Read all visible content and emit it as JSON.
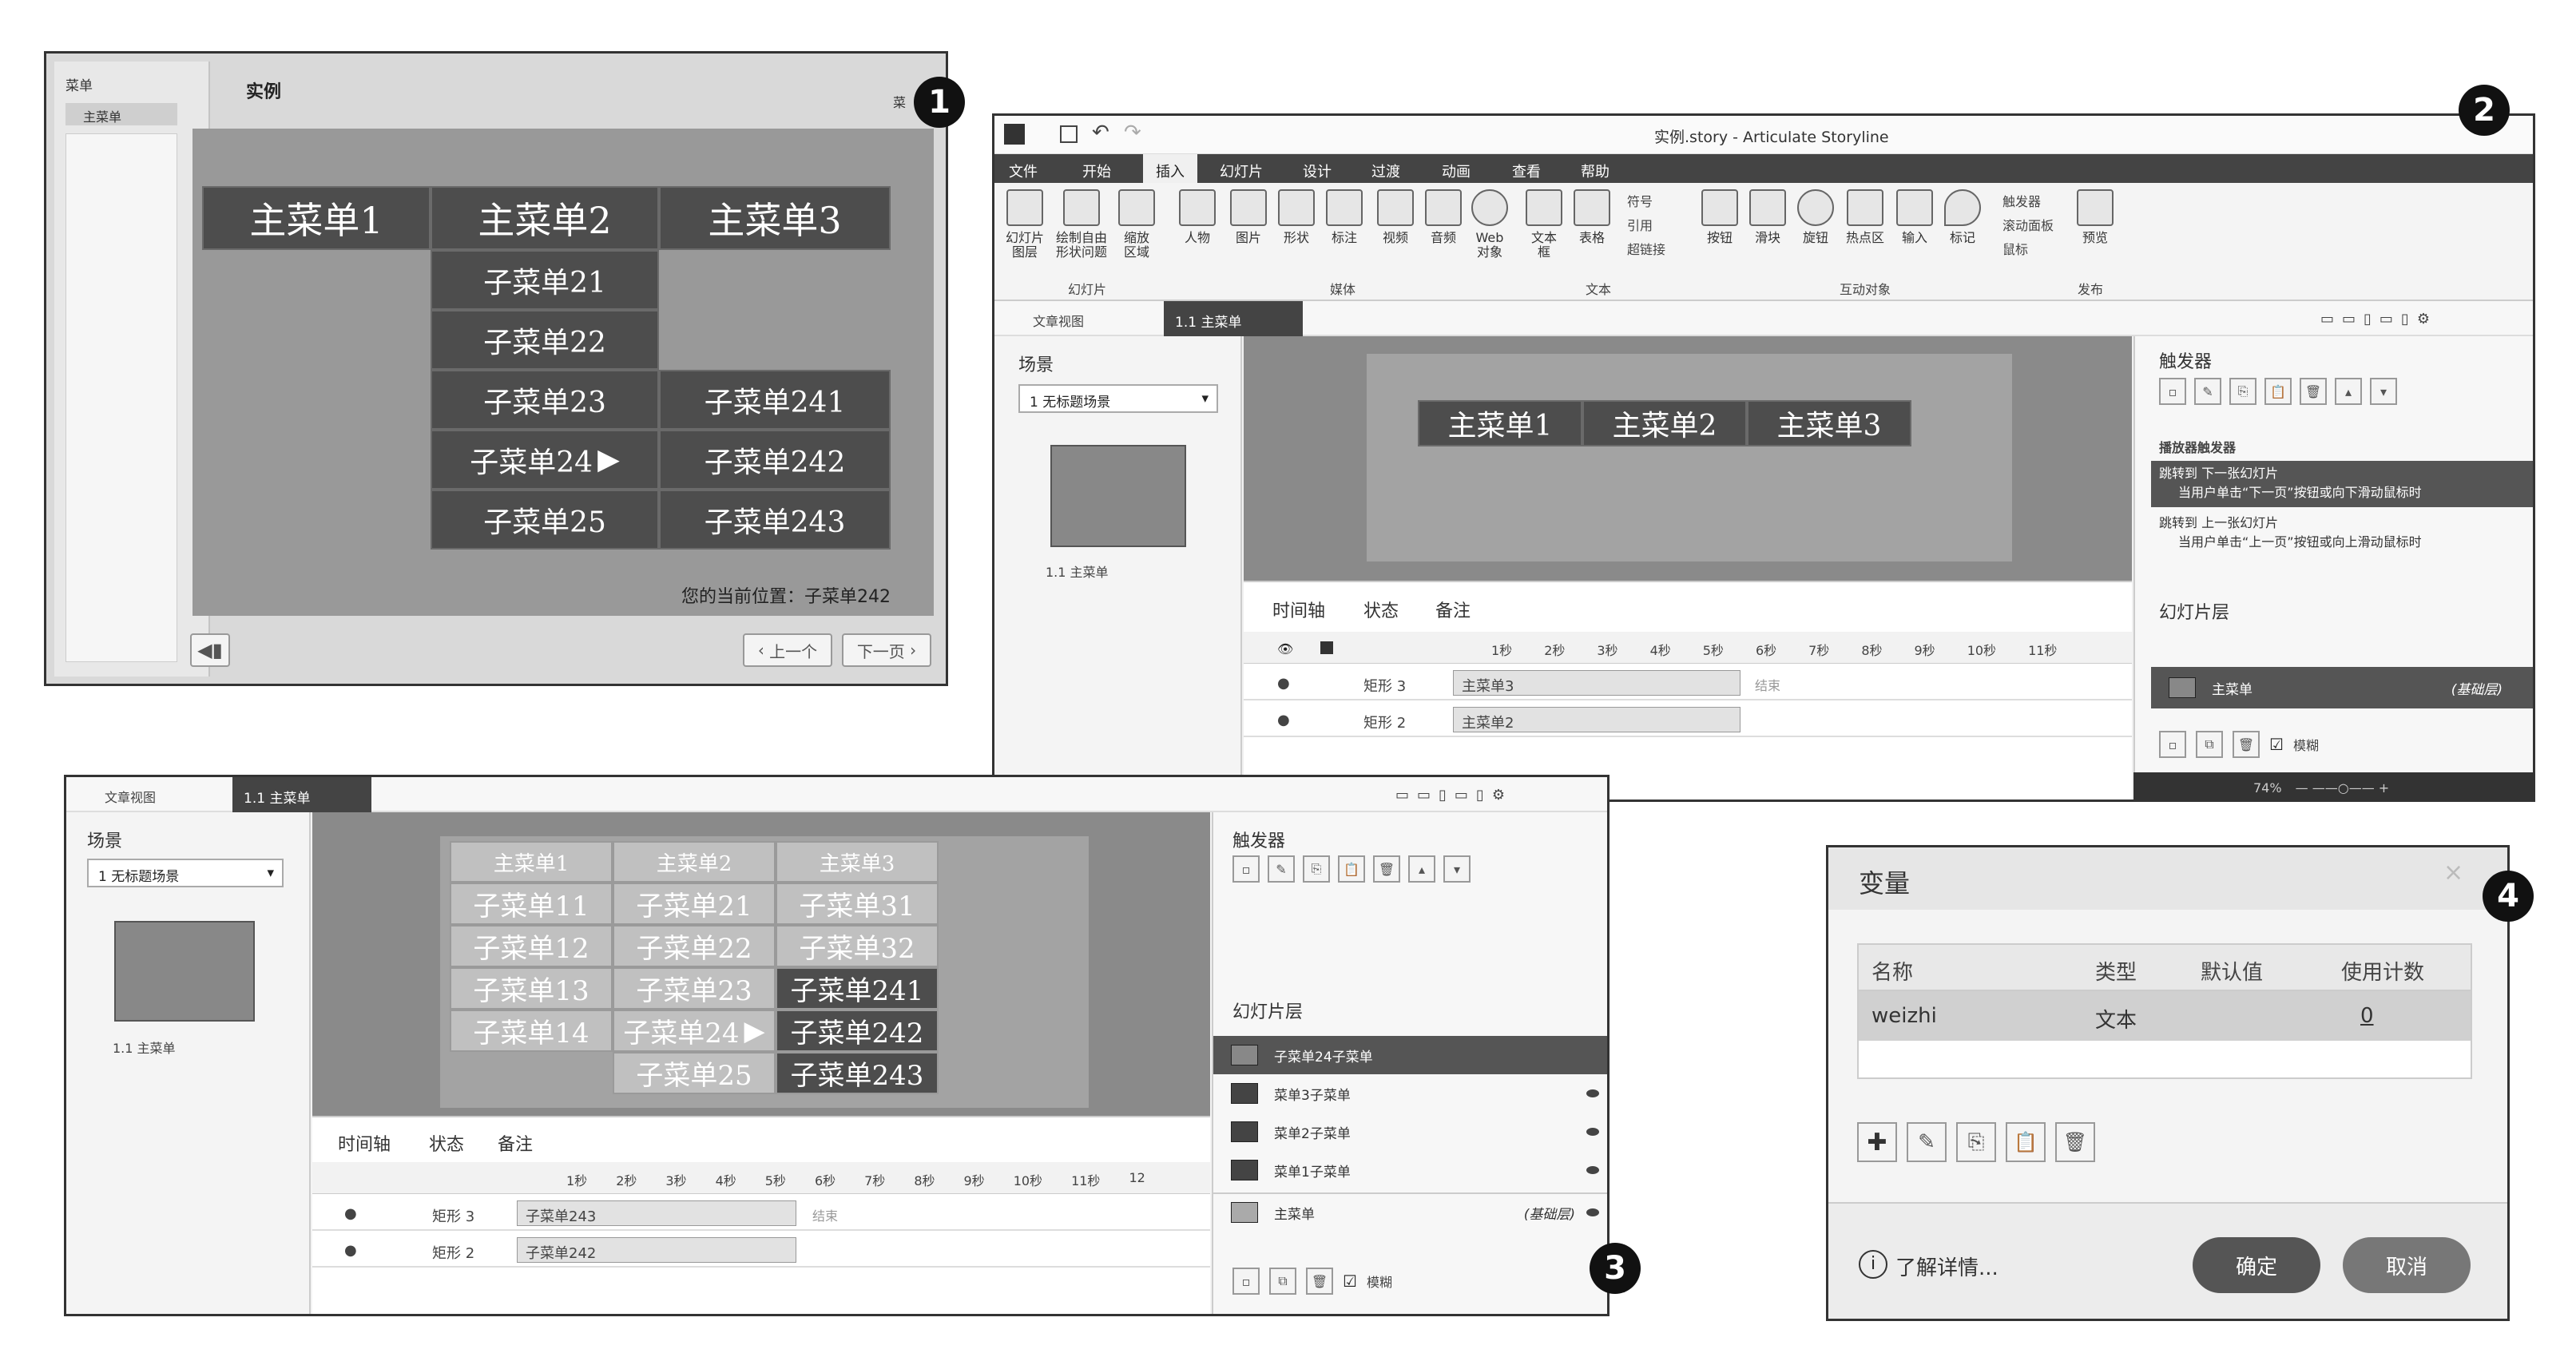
{
  "badges": [
    "1",
    "2",
    "3",
    "4"
  ],
  "panel1": {
    "sidebar_tab": "菜单",
    "sidebar_item": "主菜单",
    "title": "实例",
    "side_label": "菜",
    "menu_top": [
      "主菜单1",
      "主菜单2",
      "主菜单3"
    ],
    "menu_col2": [
      "子菜单21",
      "子菜单22",
      "子菜单23",
      "子菜单24",
      "子菜单25"
    ],
    "menu_col3": [
      "子菜单241",
      "子菜单242",
      "子菜单243"
    ],
    "arrow": "▶",
    "location": "您的当前位置：子菜单242",
    "volume_icon": "speaker-icon",
    "prev": "上一个",
    "next": "下一页"
  },
  "panel2": {
    "window_title": "实例.story - Articulate Storyline",
    "tabs": [
      "文件",
      "开始",
      "插入",
      "幻灯片",
      "设计",
      "过渡",
      "动画",
      "查看",
      "帮助"
    ],
    "active_tab": "插入",
    "ribbon": [
      {
        "label": "幻灯片\n图层"
      },
      {
        "label": "绘制自由\n形状问题"
      },
      {
        "label": "缩放\n区域"
      },
      {
        "label": "人物"
      },
      {
        "label": "图片"
      },
      {
        "label": "形状"
      },
      {
        "label": "标注"
      },
      {
        "label": "视频"
      },
      {
        "label": "音频"
      },
      {
        "label": "Web\n对象"
      },
      {
        "label": "文本\n框"
      },
      {
        "label": "表格"
      },
      {
        "label": "按钮"
      },
      {
        "label": "滑块"
      },
      {
        "label": "旋钮"
      },
      {
        "label": "热点区"
      },
      {
        "label": "输入"
      },
      {
        "label": "标记"
      },
      {
        "label": "预览"
      }
    ],
    "ribbon_small": [
      "符号",
      "引用",
      "超链接",
      "触发器",
      "滚动面板",
      "鼠标"
    ],
    "groups": [
      "幻灯片",
      "媒体",
      "文本",
      "互动对象",
      "发布"
    ],
    "doc_tabs": [
      "文章视图",
      "1.1 主菜单"
    ],
    "scenes_label": "场景",
    "scene_select": "1 无标题场景",
    "slide_label": "1.1 主菜单",
    "menu_top": [
      "主菜单1",
      "主菜单2",
      "主菜单3"
    ],
    "timeline_tabs": [
      "时间轴",
      "状态",
      "备注"
    ],
    "ruler": [
      "1秒",
      "2秒",
      "3秒",
      "4秒",
      "5秒",
      "6秒",
      "7秒",
      "8秒",
      "9秒",
      "10秒",
      "11秒"
    ],
    "rows": [
      {
        "name": "矩形 3",
        "bar": "主菜单3"
      },
      {
        "name": "矩形 2",
        "bar": "主菜单2"
      }
    ],
    "end_label": "结束",
    "triggers_label": "触发器",
    "trigger_section": "播放器触发器",
    "triggers": [
      {
        "a": "跳转到 下一张幻灯片",
        "b": "当用户单击“下一页”按钮或向下滑动鼠标时"
      },
      {
        "a": "跳转到 上一张幻灯片",
        "b": "当用户单击“上一页”按钮或向上滑动鼠标时"
      }
    ],
    "layers_label": "幻灯片层",
    "base_layer": "主菜单",
    "base_tag": "(基础层)",
    "dim_label": "模糊",
    "zoom": "74%"
  },
  "panel3": {
    "doc_tabs": [
      "文章视图",
      "1.1 主菜单"
    ],
    "scenes_label": "场景",
    "scene_select": "1 无标题场景",
    "slide_label": "1.1 主菜单",
    "menu_top": [
      "主菜单1",
      "主菜单2",
      "主菜单3"
    ],
    "col1": [
      "子菜单11",
      "子菜单12",
      "子菜单13",
      "子菜单14"
    ],
    "col2": [
      "子菜单21",
      "子菜单22",
      "子菜单23",
      "子菜单24",
      "子菜单25"
    ],
    "col3a": [
      "子菜单31",
      "子菜单32"
    ],
    "col3b": [
      "子菜单241",
      "子菜单242",
      "子菜单243"
    ],
    "arrow": "▶",
    "timeline_tabs": [
      "时间轴",
      "状态",
      "备注"
    ],
    "ruler": [
      "1秒",
      "2秒",
      "3秒",
      "4秒",
      "5秒",
      "6秒",
      "7秒",
      "8秒",
      "9秒",
      "10秒",
      "11秒",
      "12"
    ],
    "rows": [
      {
        "name": "矩形 3",
        "bar": "子菜单243"
      },
      {
        "name": "矩形 2",
        "bar": "子菜单242"
      }
    ],
    "end_label": "结束",
    "triggers_label": "触发器",
    "layers_label": "幻灯片层",
    "layers": [
      "子菜单24子菜单",
      "菜单3子菜单",
      "菜单2子菜单",
      "菜单1子菜单"
    ],
    "base_layer": "主菜单",
    "base_tag": "(基础层)",
    "dim_label": "模糊"
  },
  "panel4": {
    "title": "变量",
    "headers": [
      "名称",
      "类型",
      "默认值",
      "使用计数"
    ],
    "row": {
      "name": "weizhi",
      "type": "文本",
      "default": "",
      "count": "0"
    },
    "learn": "了解详情...",
    "ok": "确定",
    "cancel": "取消"
  }
}
